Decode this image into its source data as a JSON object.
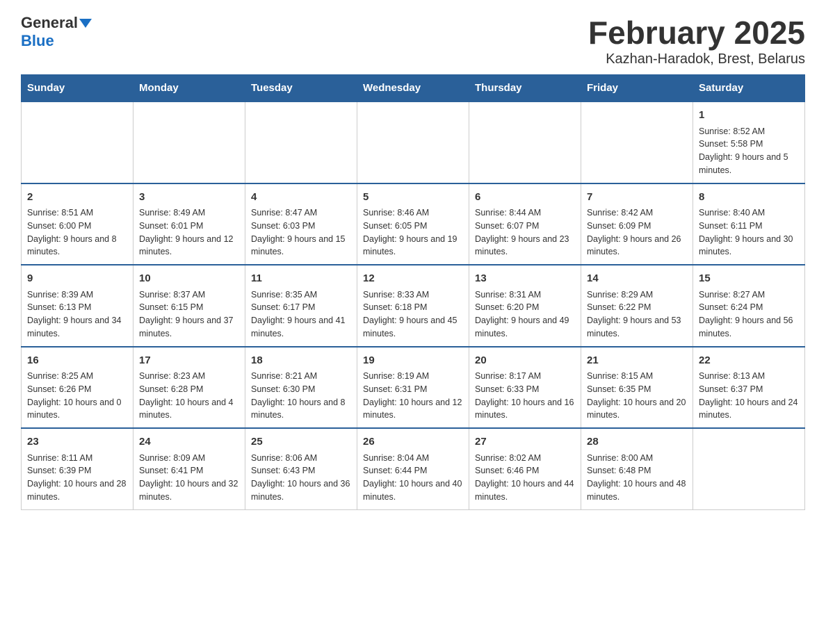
{
  "header": {
    "logo_general": "General",
    "logo_blue": "Blue",
    "month_title": "February 2025",
    "subtitle": "Kazhan-Haradok, Brest, Belarus"
  },
  "days_of_week": [
    "Sunday",
    "Monday",
    "Tuesday",
    "Wednesday",
    "Thursday",
    "Friday",
    "Saturday"
  ],
  "weeks": [
    [
      {
        "day": "",
        "info": ""
      },
      {
        "day": "",
        "info": ""
      },
      {
        "day": "",
        "info": ""
      },
      {
        "day": "",
        "info": ""
      },
      {
        "day": "",
        "info": ""
      },
      {
        "day": "",
        "info": ""
      },
      {
        "day": "1",
        "info": "Sunrise: 8:52 AM\nSunset: 5:58 PM\nDaylight: 9 hours and 5 minutes."
      }
    ],
    [
      {
        "day": "2",
        "info": "Sunrise: 8:51 AM\nSunset: 6:00 PM\nDaylight: 9 hours and 8 minutes."
      },
      {
        "day": "3",
        "info": "Sunrise: 8:49 AM\nSunset: 6:01 PM\nDaylight: 9 hours and 12 minutes."
      },
      {
        "day": "4",
        "info": "Sunrise: 8:47 AM\nSunset: 6:03 PM\nDaylight: 9 hours and 15 minutes."
      },
      {
        "day": "5",
        "info": "Sunrise: 8:46 AM\nSunset: 6:05 PM\nDaylight: 9 hours and 19 minutes."
      },
      {
        "day": "6",
        "info": "Sunrise: 8:44 AM\nSunset: 6:07 PM\nDaylight: 9 hours and 23 minutes."
      },
      {
        "day": "7",
        "info": "Sunrise: 8:42 AM\nSunset: 6:09 PM\nDaylight: 9 hours and 26 minutes."
      },
      {
        "day": "8",
        "info": "Sunrise: 8:40 AM\nSunset: 6:11 PM\nDaylight: 9 hours and 30 minutes."
      }
    ],
    [
      {
        "day": "9",
        "info": "Sunrise: 8:39 AM\nSunset: 6:13 PM\nDaylight: 9 hours and 34 minutes."
      },
      {
        "day": "10",
        "info": "Sunrise: 8:37 AM\nSunset: 6:15 PM\nDaylight: 9 hours and 37 minutes."
      },
      {
        "day": "11",
        "info": "Sunrise: 8:35 AM\nSunset: 6:17 PM\nDaylight: 9 hours and 41 minutes."
      },
      {
        "day": "12",
        "info": "Sunrise: 8:33 AM\nSunset: 6:18 PM\nDaylight: 9 hours and 45 minutes."
      },
      {
        "day": "13",
        "info": "Sunrise: 8:31 AM\nSunset: 6:20 PM\nDaylight: 9 hours and 49 minutes."
      },
      {
        "day": "14",
        "info": "Sunrise: 8:29 AM\nSunset: 6:22 PM\nDaylight: 9 hours and 53 minutes."
      },
      {
        "day": "15",
        "info": "Sunrise: 8:27 AM\nSunset: 6:24 PM\nDaylight: 9 hours and 56 minutes."
      }
    ],
    [
      {
        "day": "16",
        "info": "Sunrise: 8:25 AM\nSunset: 6:26 PM\nDaylight: 10 hours and 0 minutes."
      },
      {
        "day": "17",
        "info": "Sunrise: 8:23 AM\nSunset: 6:28 PM\nDaylight: 10 hours and 4 minutes."
      },
      {
        "day": "18",
        "info": "Sunrise: 8:21 AM\nSunset: 6:30 PM\nDaylight: 10 hours and 8 minutes."
      },
      {
        "day": "19",
        "info": "Sunrise: 8:19 AM\nSunset: 6:31 PM\nDaylight: 10 hours and 12 minutes."
      },
      {
        "day": "20",
        "info": "Sunrise: 8:17 AM\nSunset: 6:33 PM\nDaylight: 10 hours and 16 minutes."
      },
      {
        "day": "21",
        "info": "Sunrise: 8:15 AM\nSunset: 6:35 PM\nDaylight: 10 hours and 20 minutes."
      },
      {
        "day": "22",
        "info": "Sunrise: 8:13 AM\nSunset: 6:37 PM\nDaylight: 10 hours and 24 minutes."
      }
    ],
    [
      {
        "day": "23",
        "info": "Sunrise: 8:11 AM\nSunset: 6:39 PM\nDaylight: 10 hours and 28 minutes."
      },
      {
        "day": "24",
        "info": "Sunrise: 8:09 AM\nSunset: 6:41 PM\nDaylight: 10 hours and 32 minutes."
      },
      {
        "day": "25",
        "info": "Sunrise: 8:06 AM\nSunset: 6:43 PM\nDaylight: 10 hours and 36 minutes."
      },
      {
        "day": "26",
        "info": "Sunrise: 8:04 AM\nSunset: 6:44 PM\nDaylight: 10 hours and 40 minutes."
      },
      {
        "day": "27",
        "info": "Sunrise: 8:02 AM\nSunset: 6:46 PM\nDaylight: 10 hours and 44 minutes."
      },
      {
        "day": "28",
        "info": "Sunrise: 8:00 AM\nSunset: 6:48 PM\nDaylight: 10 hours and 48 minutes."
      },
      {
        "day": "",
        "info": ""
      }
    ]
  ]
}
